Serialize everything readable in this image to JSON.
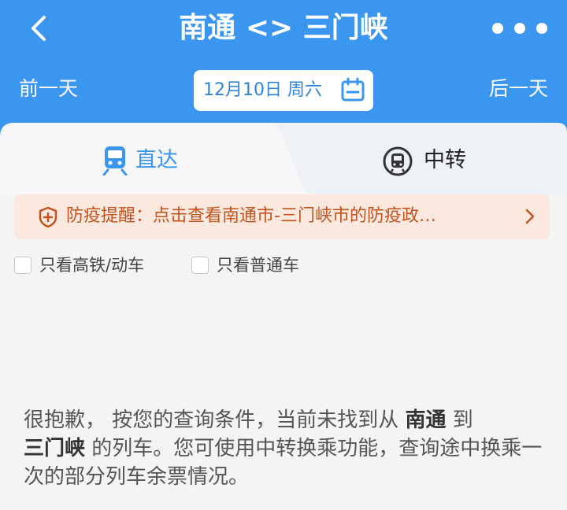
{
  "header": {
    "title": "南通 <> 三门峡",
    "prev_day": "前一天",
    "next_day": "后一天",
    "date": "12月10日 周六",
    "accent": "#3b96f0"
  },
  "tabs": [
    {
      "label": "直达",
      "active": true,
      "icon": "train-icon"
    },
    {
      "label": "中转",
      "active": false,
      "icon": "transfer-icon"
    }
  ],
  "notice": {
    "text": "防疫提醒：点击查看南通市-三门峡市的防疫政…",
    "color": "#c2531e"
  },
  "filters": [
    {
      "label": "只看高铁/动车",
      "checked": false
    },
    {
      "label": "只看普通车",
      "checked": false
    }
  ],
  "message": {
    "part1": "很抱歉， 按您的查询条件，当前未找到从 ",
    "from": "南通",
    "part2": " 到",
    "to": "三门峡",
    "part3": " 的列车。您可使用中转换乘功能，查询途中换乘一次的部分列车余票情况。"
  }
}
